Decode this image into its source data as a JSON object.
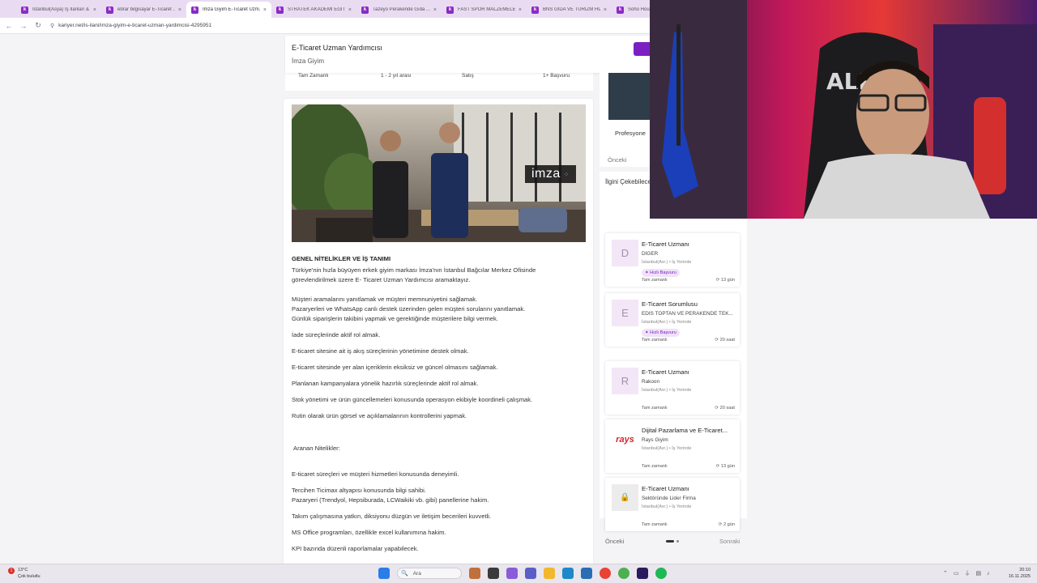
{
  "tabs": [
    {
      "label": "İstanbul(Asya) İş İlanları & ...",
      "active": false
    },
    {
      "label": "ebrar bilgisayar E-Ticaret ...",
      "active": false
    },
    {
      "label": "İmza Giyim E-Ticaret Uzm...",
      "active": true
    },
    {
      "label": "STRATEK AKADEMİ EĞİTİ...",
      "active": false
    },
    {
      "label": "Tazeyo Perakende Gıda ...",
      "active": false
    },
    {
      "label": "FAST SPOR MALZEMELE...",
      "active": false
    },
    {
      "label": "BNS GIDA VE TURİZM HİZ...",
      "active": false
    },
    {
      "label": "Soho House ...",
      "active": false
    }
  ],
  "tab_favicon": "k",
  "url": "kariyer.net/is-ilani/imza-giyim-e-ticaret-uzman-yardimcisi-4295951",
  "job": {
    "title": "E-Ticaret Uzman Yardımcısı",
    "company": "İmza Giyim",
    "info": [
      "Tam Zamanlı",
      "1 - 2 yıl arası",
      "Satış",
      "1+ Başvuru"
    ],
    "logo_text": "imza",
    "logo_dots": "⁘"
  },
  "description": {
    "heading": "GENEL NİTELİKLER VE İŞ TANIMI",
    "intro": [
      "Türkiye'nin hızla büyüyen erkek giyim markası İmza'nın İstanbul Bağcılar Merkez Ofisinde",
      "görevlendirilmek üzere E- Ticaret Uzman Yardımcısı aramaktayız."
    ],
    "duties": [
      "Müşteri aramalarını yanıtlamak ve müşteri memnuniyetini sağlamak.",
      "Pazaryerleri ve WhatsApp canlı destek üzerinden gelen müşteri sorularını yanıtlamak.",
      "Günlük siparişlerin takibini yapmak ve gerektiğinde müşterilere bilgi vermek.",
      "İade süreçlerinde aktif rol almak.",
      "E-ticaret sitesine ait iş akış süreçlerinin yönetimine destek olmak.",
      "E-ticaret sitesinde yer alan içeriklerin eksiksiz ve güncel olmasını sağlamak.",
      "Planlanan kampanyalara yönelik hazırlık süreçlerinde aktif rol almak.",
      "Stok yönetimi ve ürün güncellemeleri konusunda operasyon ekibiyle koordineli çalışmak.",
      "Rutin olarak ürün görsel ve açıklamalarının kontrollerini yapmak."
    ],
    "qual_heading": "Aranan Nitelikler:",
    "quals": [
      "E-ticaret süreçleri ve müşteri hizmetleri konusunda deneyimli.",
      "Tercihen Ticimax altyapısı konusunda bilgi sahibi.",
      "Pazaryeri (Trendyol, Hepsiburada, LCWaikiki vb. gibi) panellerine hakim.",
      "Takım çalışmasına yatkın, diksiyonu düzgün ve iletişim becerileri kuvvetli.",
      "MS Office programları, özellikle excel kullanımına hakim.",
      "KPI bazında düzenli raporlamalar yapabilecek."
    ]
  },
  "right_top": {
    "label": "Profesyone",
    "prev": "Önceki"
  },
  "related": {
    "title": "İlgini Çekebilecek İlanlar",
    "cards": [
      {
        "logo": "D",
        "title": "E-Ticaret Uzmanı",
        "company": "DİĞER",
        "location": "İstanbul(Avr.) • İş Yerinde",
        "badge": "✦ Hızlı Başvuru",
        "work": "Tam zamanlı",
        "age": "13 gün"
      },
      {
        "logo": "E",
        "title": "E-Ticaret Sorumlusu",
        "company": "EDİS TOPTAN VE PERAKENDE TEK...",
        "location": "İstanbul(Avr.) • İş Yerinde",
        "badge": "✦ Hızlı Başvuru",
        "work": "Tam zamanlı",
        "age": "20 saat"
      },
      {
        "logo": "R",
        "title": "E-Ticaret Uzmanı",
        "company": "Rakoon",
        "location": "İstanbul(Avr.) • İş Yerinde",
        "badge": "",
        "work": "Tam zamanlı",
        "age": "20 saat"
      },
      {
        "logo": "rays",
        "title": "Dijital Pazarlama ve E-Ticaret...",
        "company": "Rays Giyim",
        "location": "İstanbul(Avr.) • İş Yerinde",
        "badge": "",
        "work": "Tam zamanlı",
        "age": "13 gün"
      },
      {
        "logo": "🔒",
        "title": "E-Ticaret Uzmanı",
        "company": "Sektöründe Lider Firma",
        "location": "İstanbul(Avr.) • İş Yerinde",
        "badge": "",
        "work": "Tam zamanlı",
        "age": "2 gün"
      }
    ],
    "prev": "Önceki",
    "next": "Sonraki"
  },
  "taskbar": {
    "weather_temp": "13°C",
    "weather_desc": "Çok bulutlu",
    "weather_badge": "1",
    "search_placeholder": "Ara",
    "time": "20:10",
    "date": "16.11.2025"
  },
  "icons": {
    "back": "←",
    "forward": "→",
    "reload": "↻",
    "lock": "⚲",
    "close": "×",
    "search": "🔍",
    "age": "⟳"
  },
  "colors": {
    "brand": "#7b1fc2",
    "badge_bg": "#efe3f7",
    "tabbar": "#e9dcf2"
  }
}
